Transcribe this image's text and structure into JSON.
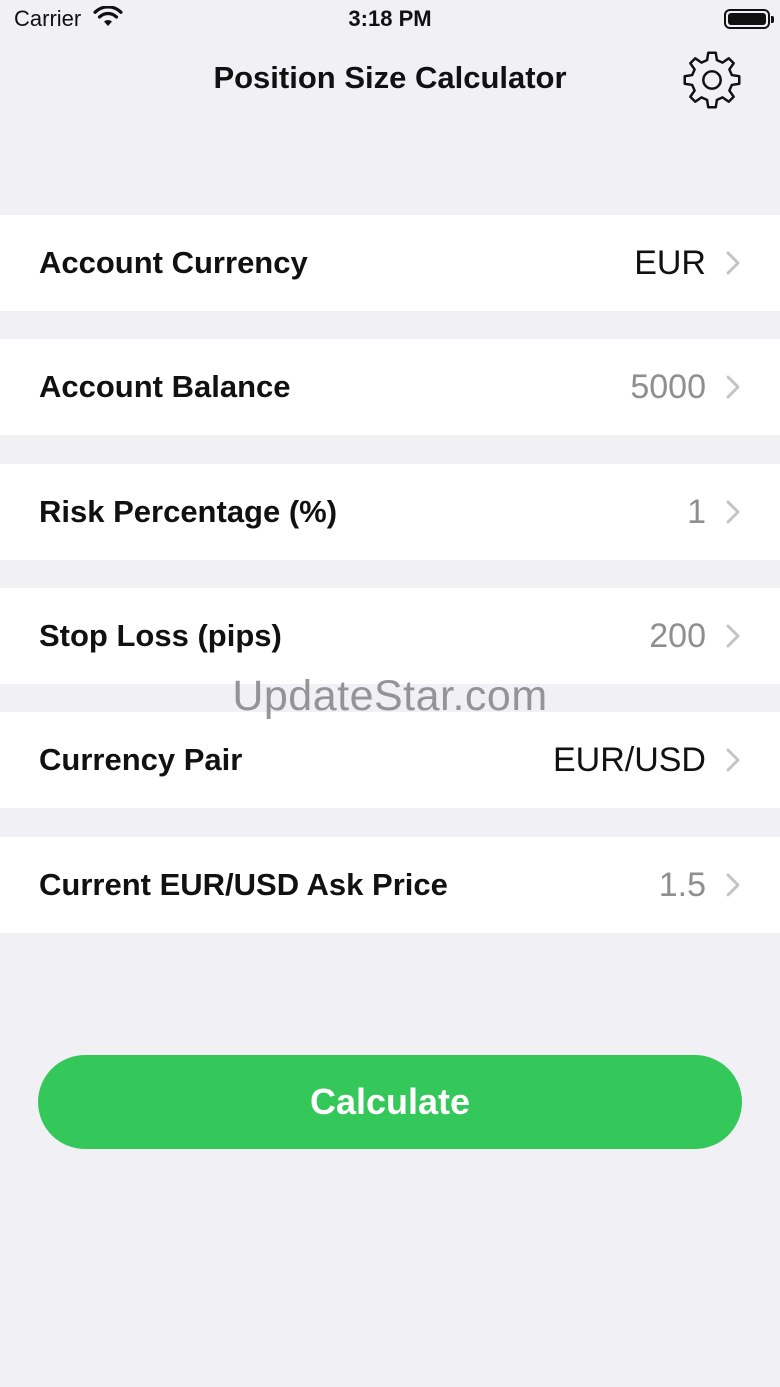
{
  "status_bar": {
    "carrier": "Carrier",
    "time": "3:18 PM"
  },
  "nav": {
    "title": "Position Size Calculator",
    "settings_icon": "gear-icon"
  },
  "rows": [
    {
      "label": "Account Currency",
      "value": "EUR"
    },
    {
      "label": "Account Balance",
      "value": "5000"
    },
    {
      "label": "Risk Percentage (%)",
      "value": "1"
    },
    {
      "label": "Stop Loss (pips)",
      "value": "200"
    },
    {
      "label": "Currency Pair",
      "value": "EUR/USD"
    },
    {
      "label": "Current EUR/USD Ask Price",
      "value": "1.5"
    }
  ],
  "watermark": "UpdateStar.com",
  "calculate_button": {
    "label": "Calculate"
  },
  "colors": {
    "background": "#f0f0f5",
    "accent_green": "#34c759",
    "secondary_text": "#8e8e93"
  }
}
